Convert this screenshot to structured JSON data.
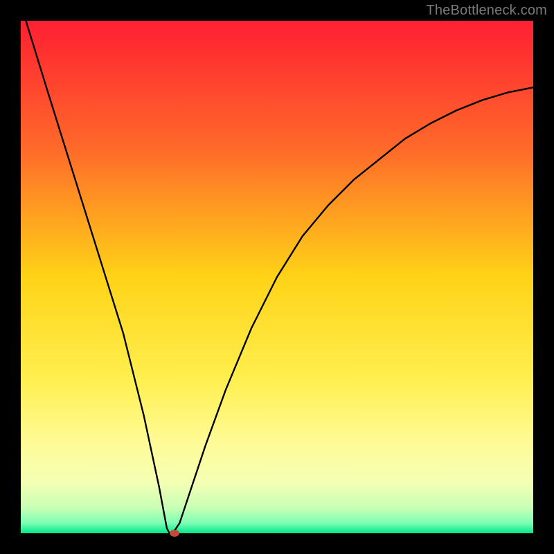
{
  "watermark": "TheBottleneck.com",
  "colors": {
    "frame": "#000000",
    "watermark_text": "#7a7a7a",
    "curve": "#000000",
    "marker": "#c24a3a",
    "gradient_stops": [
      {
        "pos": 0.0,
        "color": "#ff1f32"
      },
      {
        "pos": 0.25,
        "color": "#ff6a2a"
      },
      {
        "pos": 0.5,
        "color": "#ffd317"
      },
      {
        "pos": 0.7,
        "color": "#ffef4f"
      },
      {
        "pos": 0.82,
        "color": "#fffb95"
      },
      {
        "pos": 0.9,
        "color": "#f4ffb4"
      },
      {
        "pos": 0.95,
        "color": "#c8ffb4"
      },
      {
        "pos": 0.98,
        "color": "#7dffb4"
      },
      {
        "pos": 1.0,
        "color": "#00e88a"
      }
    ]
  },
  "chart_data": {
    "type": "line",
    "title": "",
    "xlabel": "",
    "ylabel": "",
    "xlim": [
      0,
      100
    ],
    "ylim": [
      0,
      100
    ],
    "optimum_x": 29,
    "series": [
      {
        "name": "bottleneck-curve",
        "x": [
          1,
          5,
          10,
          15,
          20,
          24,
          27,
          28.5,
          29,
          30,
          31,
          33,
          36,
          40,
          45,
          50,
          55,
          60,
          65,
          70,
          75,
          80,
          85,
          90,
          95,
          100
        ],
        "y": [
          100,
          87,
          71,
          55,
          39,
          23,
          9,
          1,
          0,
          0.5,
          2,
          8,
          17,
          28,
          40,
          50,
          58,
          64,
          69,
          73,
          77,
          80,
          82.5,
          84.5,
          86,
          87
        ]
      }
    ],
    "marker": {
      "x": 30,
      "y": 0
    }
  }
}
